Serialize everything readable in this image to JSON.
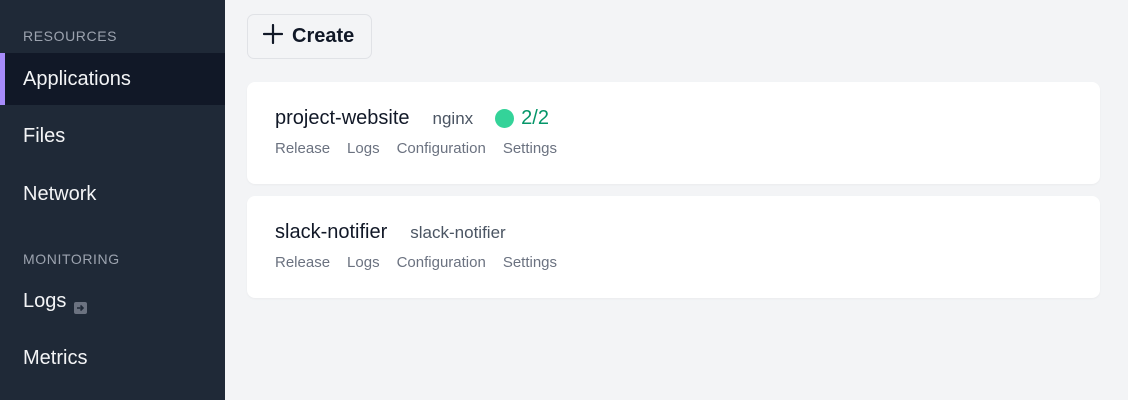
{
  "sidebar": {
    "sections": [
      {
        "title": "RESOURCES",
        "items": [
          {
            "label": "Applications",
            "active": true
          },
          {
            "label": "Files"
          },
          {
            "label": "Network"
          }
        ]
      },
      {
        "title": "MONITORING",
        "items": [
          {
            "label": "Logs",
            "icon": "external-link-icon"
          },
          {
            "label": "Metrics"
          }
        ]
      }
    ],
    "accent_color": "#a78bfa"
  },
  "toolbar": {
    "create_label": "Create",
    "create_icon": "plus-icon"
  },
  "apps": [
    {
      "name": "project-website",
      "image": "nginx",
      "status": "2/2",
      "status_color": "#34d399",
      "links": [
        "Release",
        "Logs",
        "Configuration",
        "Settings"
      ]
    },
    {
      "name": "slack-notifier",
      "image": "slack-notifier",
      "links": [
        "Release",
        "Logs",
        "Configuration",
        "Settings"
      ]
    }
  ]
}
